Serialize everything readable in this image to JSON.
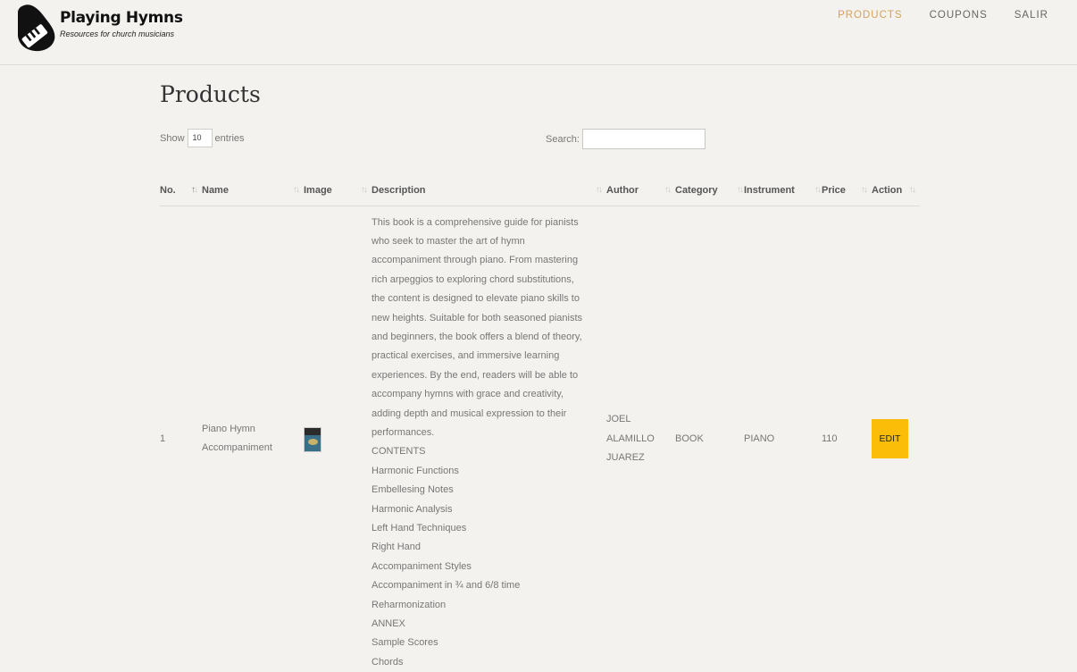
{
  "brand": {
    "name": "Playing Hymns",
    "tagline": "Resources for church musicians"
  },
  "nav": [
    {
      "label": "PRODUCTS",
      "active": true
    },
    {
      "label": "COUPONS",
      "active": false
    },
    {
      "label": "SALIR",
      "active": false
    }
  ],
  "page": {
    "title": "Products"
  },
  "controls": {
    "show_label": "Show",
    "entries_value": "10",
    "entries_label": "entries",
    "search_label": "Search:",
    "search_value": ""
  },
  "table": {
    "columns": [
      "No.",
      "Name",
      "Image",
      "Description",
      "Author",
      "Category",
      "Instrument",
      "Price",
      "Action"
    ],
    "rows": [
      {
        "no": "1",
        "name_lines": [
          "Piano Hymn",
          "Accompaniment"
        ],
        "image": "book-cover-thumbnail",
        "description_lines": [
          "This book is a comprehensive guide for pianists",
          "who seek to master the art of hymn",
          "accompaniment through piano. From mastering",
          "rich arpeggios to exploring chord substitutions,",
          "the content is designed to elevate piano skills to",
          "new heights. Suitable for both seasoned pianists",
          "and beginners, the book offers a blend of theory,",
          "practical exercises, and immersive learning",
          "experiences. By the end, readers will be able to",
          "accompany hymns with grace and creativity,",
          "adding depth and musical expression to their",
          "performances.",
          "CONTENTS",
          "Harmonic Functions",
          "Embellesing Notes",
          "Harmonic Analysis",
          "Left Hand Techniques",
          "Right Hand",
          "Accompaniment Styles",
          "Accompaniment in ¾ and 6/8 time",
          "Reharmonization",
          "ANNEX",
          "Sample Scores",
          "Chords"
        ],
        "author_lines": [
          "JOEL",
          "ALAMILLO",
          "JUAREZ"
        ],
        "category": "BOOK",
        "instrument": "PIANO",
        "price": "110",
        "action_label": "EDIT"
      }
    ]
  },
  "colors": {
    "accent": "#d4a15e",
    "edit_button": "#fbbd08",
    "background": "#f3f2ee"
  }
}
